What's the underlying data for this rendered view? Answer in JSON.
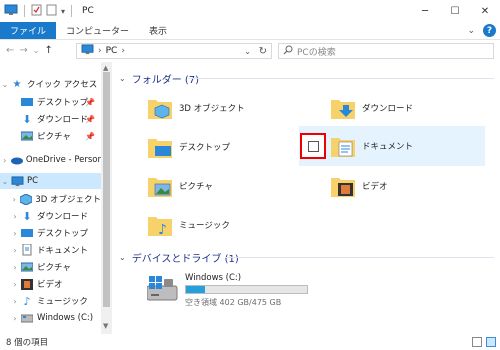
{
  "window": {
    "title": "PC"
  },
  "title_controls": [
    "minimize-icon",
    "maximize-icon",
    "close-icon"
  ],
  "ribbon": {
    "tabs": [
      "ファイル",
      "コンピューター",
      "表示"
    ],
    "help": "?"
  },
  "address": {
    "path": "PC",
    "separator": "›"
  },
  "search": {
    "placeholder": "PCの検索"
  },
  "sidebar": {
    "quick_access": "クイック アクセス",
    "quick_items": [
      "デスクトップ",
      "ダウンロード",
      "ピクチャ"
    ],
    "onedrive": "OneDrive - Persor",
    "pc": "PC",
    "pc_items": [
      "3D オブジェクト",
      "ダウンロード",
      "デスクトップ",
      "ドキュメント",
      "ピクチャ",
      "ビデオ",
      "ミュージック",
      "Windows (C:)"
    ]
  },
  "main": {
    "folders_header": "フォルダー (7)",
    "folders": [
      "3D オブジェクト",
      "ダウンロード",
      "デスクトップ",
      "ドキュメント",
      "ピクチャ",
      "ビデオ",
      "ミュージック"
    ],
    "devices_header": "デバイスとドライブ (1)",
    "drive": {
      "name": "Windows (C:)",
      "space": "空き領域 402 GB/475 GB",
      "used_fraction": 0.154
    }
  },
  "status": {
    "count": "8 個の項目"
  },
  "colors": {
    "accent": "#1979ca",
    "selection": "#cce8ff",
    "hover": "#e5f3ff",
    "highlight_box": "#e00000",
    "folder": "#f7d26b",
    "header_text": "#1e3287"
  }
}
